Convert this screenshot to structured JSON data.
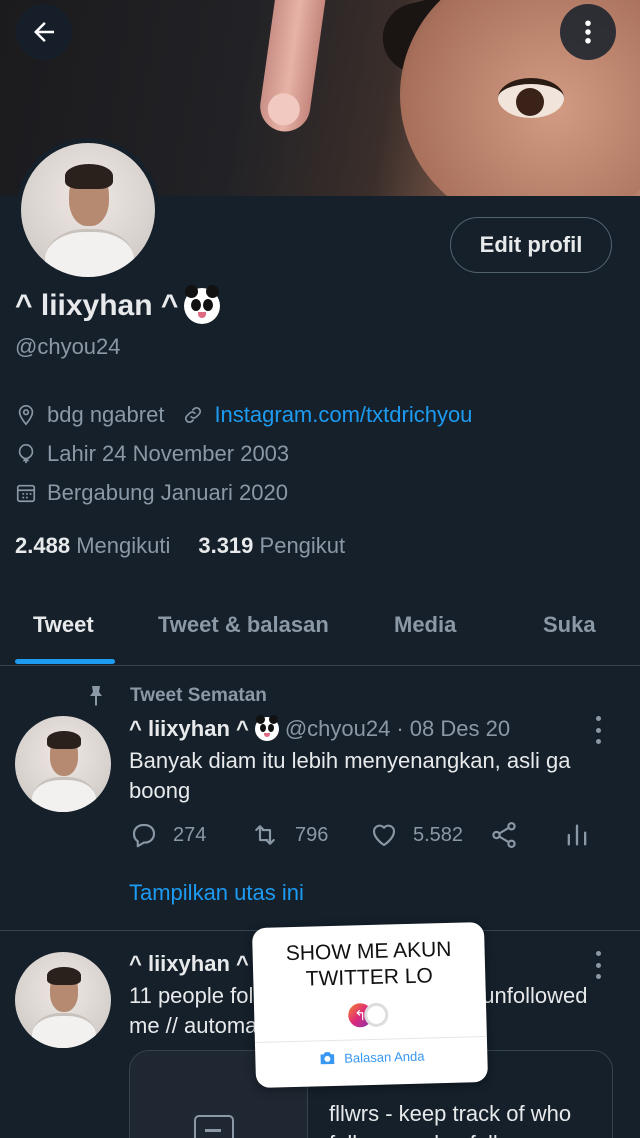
{
  "profile": {
    "display_name": "^ liixyhan ^",
    "handle": "@chyou24",
    "edit_button": "Edit profil",
    "location": "bdg ngabret",
    "website": "Instagram.com/txtdrichyou",
    "birthday": "Lahir 24 November 2003",
    "joined": "Bergabung Januari 2020",
    "following_count": "2.488",
    "following_label": "Mengikuti",
    "followers_count": "3.319",
    "followers_label": "Pengikut"
  },
  "tabs": [
    {
      "label": "Tweet",
      "active": true
    },
    {
      "label": "Tweet & balasan",
      "active": false
    },
    {
      "label": "Media",
      "active": false
    },
    {
      "label": "Suka",
      "active": false
    }
  ],
  "pinned_label": "Tweet Sematan",
  "tweets": [
    {
      "name": "^ liixyhan ^",
      "handle": "@chyou24",
      "date": "· 08 Des 20",
      "text": "Banyak diam itu lebih menyenangkan, asli ga boong",
      "replies": "274",
      "retweets": "796",
      "likes": "5.582",
      "show_thread": "Tampilkan utas ini"
    },
    {
      "name": "^ liixyhan ^",
      "text_line1_left": "11 people foll",
      "text_line1_right": "unfollowed",
      "text_line2": "me // automa",
      "card_text": "fllwrs - keep track of who follows and unfollows yo"
    }
  ],
  "story_sticker": {
    "question": "SHOW ME AKUN TWITTER LO",
    "footer": "Balasan Anda",
    "accent": "#3897f0"
  },
  "icons": [
    "arrow-left-icon",
    "more-vertical-icon",
    "location-icon",
    "link-icon",
    "balloon-icon",
    "calendar-icon",
    "pin-icon",
    "reply-icon",
    "retweet-icon",
    "heart-icon",
    "share-icon",
    "analytics-icon",
    "camera-icon"
  ],
  "colors": {
    "background": "#15202b",
    "accent": "#1d9bf0",
    "muted": "#8b98a5",
    "text": "#e7e9ea",
    "border": "#38444d"
  }
}
